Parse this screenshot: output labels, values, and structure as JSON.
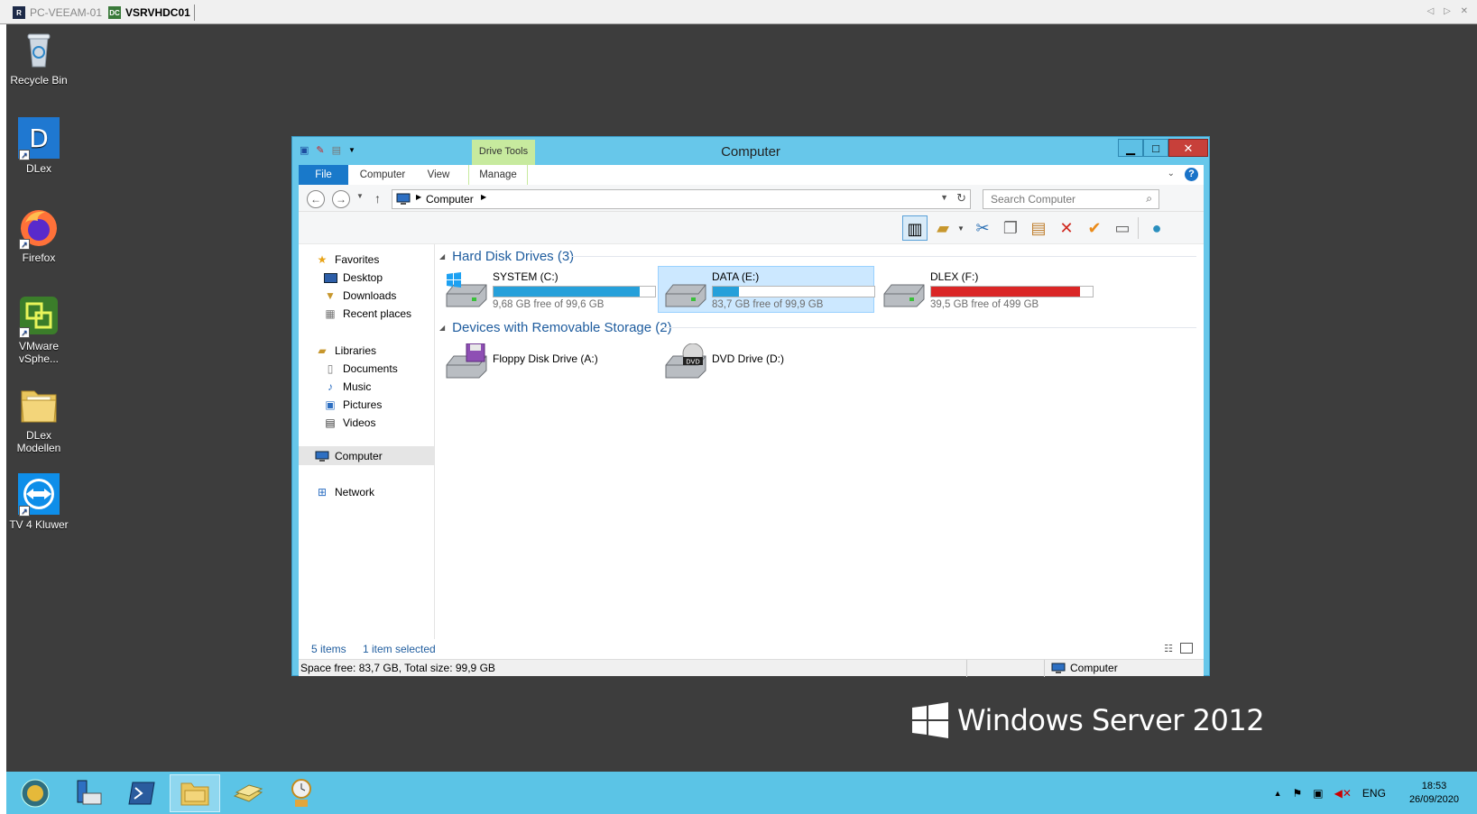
{
  "rdp": {
    "tabs": [
      {
        "label": "PC-VEEAM-01",
        "icon": "rdp-computer-icon"
      },
      {
        "label": "VSRVHDC01",
        "icon": "rdp-server-icon"
      }
    ]
  },
  "desktop": {
    "icons": [
      {
        "label": "Recycle Bin",
        "icon": "recycle-bin-icon"
      },
      {
        "label": "DLex",
        "icon": "dlex-icon"
      },
      {
        "label": "Firefox",
        "icon": "firefox-icon"
      },
      {
        "label": "VMware vSphe...",
        "icon": "vmware-vsphere-icon"
      },
      {
        "label": "DLex Modellen",
        "icon": "folder-icon"
      },
      {
        "label": "TV 4 Kluwer",
        "icon": "teamviewer-icon"
      }
    ]
  },
  "window": {
    "title": "Computer",
    "context_tab": "Drive Tools",
    "ribbon_tabs": [
      "File",
      "Computer",
      "View",
      "Manage"
    ],
    "minimize": "▁",
    "maximize": "□",
    "close": "✕",
    "address": "Computer",
    "search_placeholder": "Search Computer",
    "help": "?"
  },
  "nav_pane": {
    "favorites": {
      "label": "Favorites",
      "items": [
        "Desktop",
        "Downloads",
        "Recent places"
      ]
    },
    "libraries": {
      "label": "Libraries",
      "items": [
        "Documents",
        "Music",
        "Pictures",
        "Videos"
      ]
    },
    "computer": "Computer",
    "network": "Network"
  },
  "content": {
    "hdd_group": "Hard Disk Drives (3)",
    "removable_group": "Devices with Removable Storage (2)",
    "drives": [
      {
        "name": "SYSTEM (C:)",
        "free": "9,68 GB free of 99,6 GB",
        "used_fraction": 0.903,
        "bar_color": "#26a0da",
        "selected": false
      },
      {
        "name": "DATA (E:)",
        "free": "83,7 GB free of 99,9 GB",
        "used_fraction": 0.162,
        "bar_color": "#26a0da",
        "selected": true
      },
      {
        "name": "DLEX (F:)",
        "free": "39,5 GB free of 499 GB",
        "used_fraction": 0.921,
        "bar_color": "#da2626",
        "selected": false
      }
    ],
    "removable": [
      {
        "name": "Floppy Disk Drive (A:)"
      },
      {
        "name": "DVD Drive (D:)",
        "badge": "DVD"
      }
    ]
  },
  "status": {
    "items": "5 items",
    "selected": "1 item selected",
    "space": "Space free: 83,7 GB, Total size: 99,9 GB",
    "location": "Computer"
  },
  "branding": {
    "text": "Windows Server 2012"
  },
  "taskbar": {
    "apps": [
      "start-shell-icon",
      "server-manager-icon",
      "powershell-icon",
      "file-explorer-icon",
      "backup-icon",
      "task-scheduler-icon"
    ],
    "language": "ENG",
    "time": "18:53",
    "date": "26/09/2020"
  },
  "colors": {
    "window_frame": "#67c7ea",
    "taskbar": "#5bc4e6",
    "desktop": "#3d3d3d",
    "file_tab": "#1979ca",
    "drive_tools": "#c7ea9e"
  }
}
